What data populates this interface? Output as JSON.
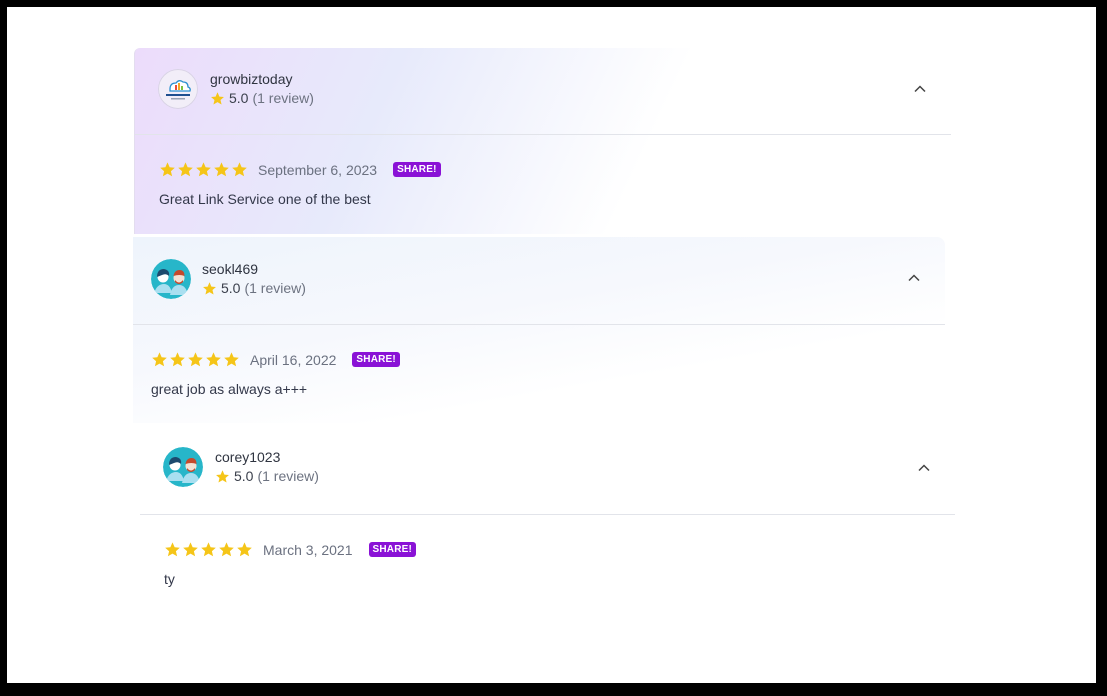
{
  "colors": {
    "star": "#f5c518",
    "share_badge": "#8a12d6",
    "avatar_teal": "#27b6c9"
  },
  "reviews": [
    {
      "username": "growbiztoday",
      "avatar": "effective-logo-avatar",
      "rating": "5.0",
      "review_count": "(1 review)",
      "stars": 5,
      "date": "September 6, 2023",
      "share_label": "SHARE!",
      "text": "Great Link Service one of the best"
    },
    {
      "username": "seokl469",
      "avatar": "people-avatar",
      "rating": "5.0",
      "review_count": "(1 review)",
      "stars": 5,
      "date": "April 16, 2022",
      "share_label": "SHARE!",
      "text": "great job as always a+++"
    },
    {
      "username": "corey1023",
      "avatar": "people-avatar",
      "rating": "5.0",
      "review_count": "(1 review)",
      "stars": 5,
      "date": "March 3, 2021",
      "share_label": "SHARE!",
      "text": "ty"
    }
  ]
}
